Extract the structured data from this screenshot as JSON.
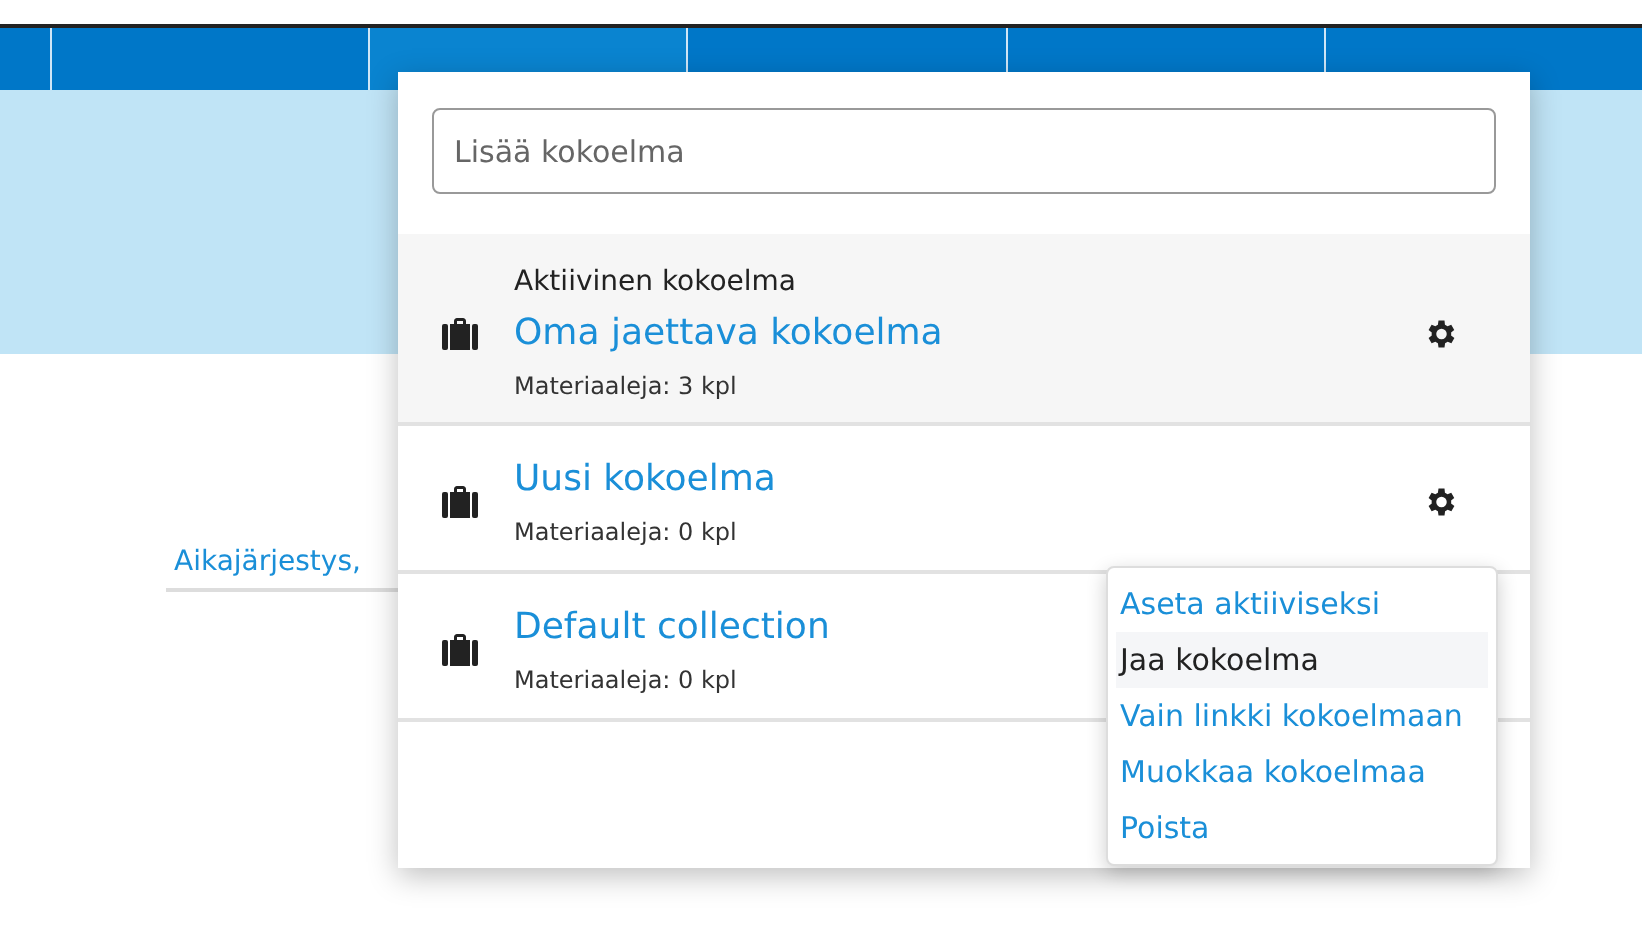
{
  "nav": {
    "segments": [
      {
        "selected": false
      },
      {
        "selected": true
      },
      {
        "selected": false
      },
      {
        "selected": false
      },
      {
        "selected": false
      }
    ]
  },
  "sort_link": "Aikajärjestys,",
  "popup": {
    "search": {
      "placeholder": "Lisää kokoelma"
    },
    "collections": [
      {
        "active": true,
        "active_label": "Aktiivinen kokoelma",
        "name": "Oma jaettava kokoelma",
        "count": "Materiaaleja: 3 kpl"
      },
      {
        "active": false,
        "name": "Uusi kokoelma",
        "count": "Materiaaleja: 0 kpl",
        "menu": [
          {
            "label": "Aseta aktiiviseksi",
            "highlighted": false
          },
          {
            "label": "Jaa kokoelma",
            "highlighted": true
          },
          {
            "label": "Vain linkki kokoelmaan",
            "highlighted": false
          },
          {
            "label": "Muokkaa kokoelmaa",
            "highlighted": false
          },
          {
            "label": "Poista",
            "highlighted": false
          }
        ]
      },
      {
        "active": false,
        "name": "Default collection",
        "count": "Materiaaleja: 0 kpl"
      }
    ]
  }
}
